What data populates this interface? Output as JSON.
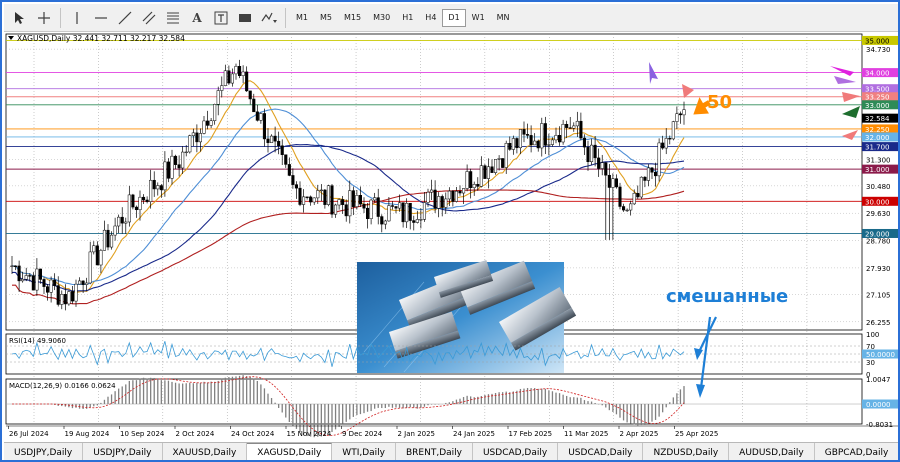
{
  "toolbar": {
    "tools": [
      "cursor-arrow",
      "crosshair",
      "vertical-line",
      "horizontal-line",
      "trend-line",
      "equidistant-channel",
      "fibonacci",
      "text-label",
      "text-box",
      "rectangle",
      "shapes-menu"
    ],
    "text_tool_label": "A",
    "timeframes": [
      "M1",
      "M5",
      "M15",
      "M30",
      "H1",
      "H4",
      "D1",
      "W1",
      "MN"
    ],
    "active_timeframe": "D1"
  },
  "chart": {
    "header": "XAGUSD,Daily  32.441 32.711 32.217 32.584",
    "rsi_label": "RSI(14) 49.9060",
    "macd_label": "MACD(12,26,9) 0.0166 0.0624",
    "annotation_50": "50",
    "annotation_mixed": "смешанные",
    "price_scale": [
      "34.730",
      "32.584",
      "31.300",
      "30.480",
      "29.630",
      "28.780",
      "27.930",
      "27.105",
      "26.255"
    ],
    "level_tags": [
      {
        "text": "35.000",
        "price": 35.0,
        "color": "#c8c800",
        "text_color": "#000000"
      },
      {
        "text": "34.000",
        "price": 34.0,
        "color": "#e040e0",
        "text_color": "#ffffff"
      },
      {
        "text": "33.500",
        "price": 33.5,
        "color": "#b06ee0",
        "text_color": "#ffffff"
      },
      {
        "text": "33.250",
        "price": 33.25,
        "color": "#f08080",
        "text_color": "#ffffff"
      },
      {
        "text": "33.000",
        "price": 33.0,
        "color": "#2e8b57",
        "text_color": "#ffffff"
      },
      {
        "text": "32.584",
        "price": 32.584,
        "color": "#000000",
        "text_color": "#ffffff"
      },
      {
        "text": "32.250",
        "price": 32.25,
        "color": "#ff8c00",
        "text_color": "#ffffff"
      },
      {
        "text": "32.000",
        "price": 32.0,
        "color": "#66b3e6",
        "text_color": "#ffffff"
      },
      {
        "text": "31.700",
        "price": 31.7,
        "color": "#1a2a8a",
        "text_color": "#ffffff"
      },
      {
        "text": "31.000",
        "price": 31.0,
        "color": "#8b1a4a",
        "text_color": "#ffffff"
      },
      {
        "text": "30.000",
        "price": 30.0,
        "color": "#cc0000",
        "text_color": "#ffffff"
      },
      {
        "text": "29.000",
        "price": 29.0,
        "color": "#1a6a8a",
        "text_color": "#ffffff"
      }
    ],
    "rsi_scale": [
      "100",
      "70",
      "50.0000",
      "30",
      "0"
    ],
    "macd_scale": [
      "1.0047",
      "0.0000",
      "-0.8031"
    ],
    "date_labels": [
      "26 Jul 2024",
      "19 Aug 2024",
      "10 Sep 2024",
      "2 Oct 2024",
      "24 Oct 2024",
      "15 Nov 2024",
      "9 Dec 2024",
      "2 Jan 2025",
      "24 Jan 2025",
      "17 Feb 2025",
      "11 Mar 2025",
      "2 Apr 2025",
      "25 Apr 2025"
    ]
  },
  "chart_data": {
    "type": "candlestick",
    "symbol": "XAGUSD",
    "timeframe": "Daily",
    "last_bar": {
      "open": 32.441,
      "high": 32.711,
      "low": 32.217,
      "close": 32.584
    },
    "x": [
      "26 Jul 2024",
      "19 Aug 2024",
      "10 Sep 2024",
      "2 Oct 2024",
      "24 Oct 2024",
      "15 Nov 2024",
      "9 Dec 2024",
      "2 Jan 2025",
      "24 Jan 2025",
      "17 Feb 2025",
      "11 Mar 2025",
      "2 Apr 2025",
      "25 Apr 2025"
    ],
    "series": [
      {
        "values": [
          28.0,
          27.0,
          29.6,
          31.3,
          34.2,
          30.4,
          29.9,
          29.6,
          30.5,
          31.8,
          32.4,
          29.5,
          32.9
        ]
      }
    ],
    "ylim": [
      26.0,
      35.2
    ],
    "rsi": {
      "value": 49.906,
      "levels": [
        70,
        50,
        30
      ]
    },
    "macd": {
      "main": 0.0166,
      "signal": 0.0624
    }
  },
  "symbol_tabs": [
    "USDJPY,Daily",
    "USDJPY,Daily",
    "XAUUSD,Daily",
    "XAGUSD,Daily",
    "WTI,Daily",
    "BRENT,Daily",
    "USDCAD,Daily",
    "USDCAD,Daily",
    "NZDUSD,Daily",
    "AUDUSD,Daily",
    "GBPCAD,Daily"
  ],
  "active_symbol_tab": 3
}
